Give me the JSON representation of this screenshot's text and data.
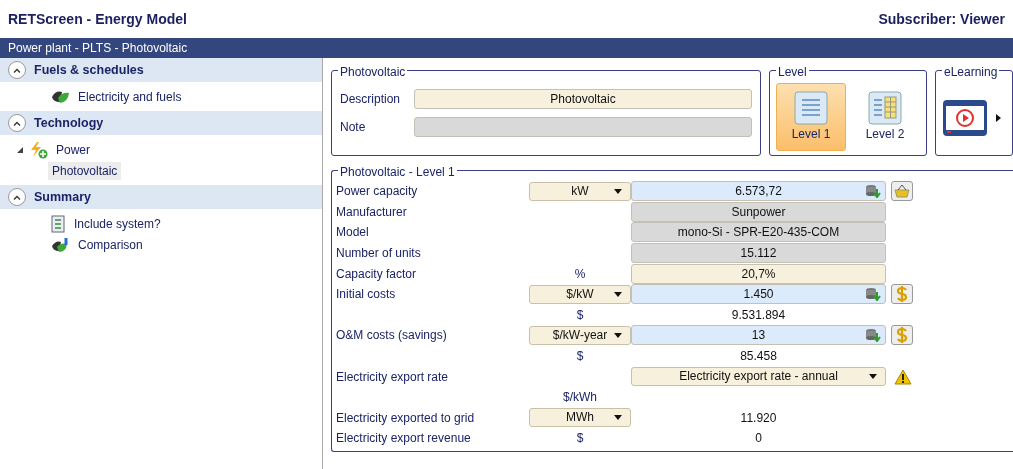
{
  "app_title": "RETScreen - Energy Model",
  "subscriber": "Subscriber: Viewer",
  "breadcrumb": "Power plant - PLTS - Photovoltaic",
  "sidebar": [
    {
      "title": "Fuels & schedules",
      "expanded": true,
      "items": [
        {
          "label": "Electricity and fuels",
          "selected": false
        }
      ]
    },
    {
      "title": "Technology",
      "expanded": true,
      "items": [
        {
          "label": "Power",
          "selected": false,
          "expanded": true,
          "children": [
            {
              "label": "Photovoltaic",
              "selected": true
            }
          ]
        }
      ]
    },
    {
      "title": "Summary",
      "expanded": true,
      "items": [
        {
          "label": "Include system?",
          "selected": false
        },
        {
          "label": "Comparison",
          "selected": false
        }
      ]
    }
  ],
  "info": {
    "title": "Photovoltaic",
    "fields": [
      {
        "label": "Description",
        "value": "Photovoltaic",
        "kind": "entry"
      },
      {
        "label": "Note",
        "kind": "readonly"
      }
    ]
  },
  "level": {
    "title": "Level",
    "options": [
      {
        "label": "Level 1",
        "selected": true
      },
      {
        "label": "Level 2",
        "selected": false
      }
    ]
  },
  "elearning": {
    "title": "eLearning"
  },
  "details": {
    "title": "Photovoltaic - Level 1",
    "rows": [
      {
        "label": "Power capacity",
        "unit": {
          "text": "kW",
          "kind": "dropdown"
        },
        "value": {
          "text": "6.573,72",
          "kind": "input"
        }
      },
      {
        "label": "Manufacturer",
        "value": {
          "text": "Sunpower",
          "kind": "readonly"
        }
      },
      {
        "label": "Model",
        "value": {
          "text": "mono-Si - SPR-E20-435-COM",
          "kind": "readonly"
        }
      },
      {
        "label": "Number of units",
        "value": {
          "text": "15.112",
          "kind": "readonly"
        }
      },
      {
        "label": "Capacity factor",
        "unit": {
          "text": "%",
          "kind": "text"
        },
        "value": {
          "text": "20,7%",
          "kind": "entry"
        }
      },
      {
        "label": "Initial costs",
        "unit": {
          "text": "$/kW",
          "kind": "dropdown"
        },
        "value": {
          "text": "1.450",
          "kind": "input"
        }
      },
      {
        "unit": {
          "text": "$",
          "kind": "text"
        },
        "value": {
          "text": "9.531.894",
          "kind": "plain"
        }
      },
      {
        "label": "O&M costs (savings)",
        "unit": {
          "text": "$/kW-year",
          "kind": "dropdown"
        },
        "value": {
          "text": "13",
          "kind": "input"
        }
      },
      {
        "unit": {
          "text": "$",
          "kind": "text"
        },
        "value": {
          "text": "85.458",
          "kind": "plain"
        }
      },
      {
        "label": "Electricity export rate",
        "value": {
          "text": "Electricity export rate - annual",
          "kind": "dropdown"
        }
      },
      {
        "unit": {
          "text": "$/kWh",
          "kind": "text"
        }
      },
      {
        "label": "Electricity exported to grid",
        "unit": {
          "text": "MWh",
          "kind": "dropdown"
        },
        "value": {
          "text": "11.920",
          "kind": "plain"
        }
      },
      {
        "label": "Electricity export revenue",
        "unit": {
          "text": "$",
          "kind": "text"
        },
        "value": {
          "text": "0",
          "kind": "plain"
        }
      }
    ]
  }
}
